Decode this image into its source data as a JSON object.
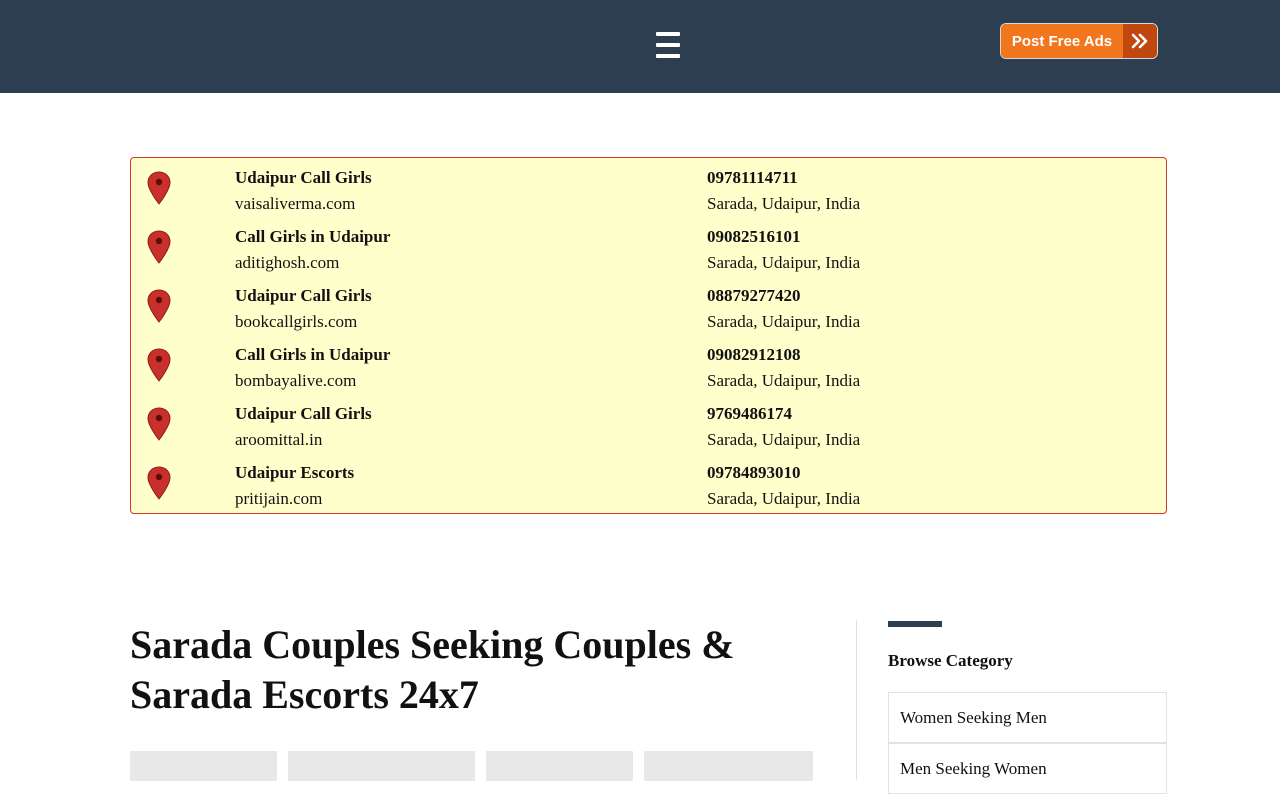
{
  "header": {
    "post_button_label": "Post Free Ads",
    "menu_icon": "hamburger-menu-icon",
    "post_arrow_icon": "double-chevron-right-icon",
    "colors": {
      "bar": "#2c3e50",
      "button": "#f2761d",
      "button_arrow": "#c0470e"
    }
  },
  "listings": [
    {
      "title": "Udaipur Call Girls",
      "site": "vaisaliverma.com",
      "phone": "09781114711",
      "location": "Sarada, Udaipur, India"
    },
    {
      "title": "Call Girls in Udaipur",
      "site": "aditighosh.com",
      "phone": "09082516101",
      "location": "Sarada, Udaipur, India"
    },
    {
      "title": "Udaipur Call Girls",
      "site": "bookcallgirls.com",
      "phone": "08879277420",
      "location": "Sarada, Udaipur, India"
    },
    {
      "title": "Call Girls in Udaipur",
      "site": "bombayalive.com",
      "phone": "09082912108",
      "location": "Sarada, Udaipur, India"
    },
    {
      "title": "Udaipur Call Girls",
      "site": "aroomittal.in",
      "phone": "9769486174",
      "location": "Sarada, Udaipur, India"
    },
    {
      "title": "Udaipur Escorts",
      "site": "pritijain.com",
      "phone": "09784893010",
      "location": "Sarada, Udaipur, India"
    }
  ],
  "main": {
    "title_line1": "Sarada Couples Seeking Couples &",
    "title_line2": "Sarada Escorts 24x7"
  },
  "sidebar": {
    "heading": "Browse Category",
    "categories": [
      "Women Seeking Men",
      "Men Seeking Women"
    ]
  }
}
